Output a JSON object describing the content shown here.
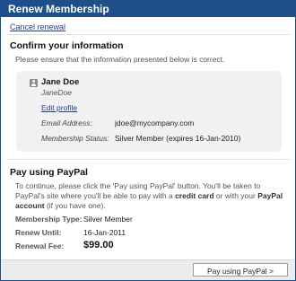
{
  "window": {
    "title": "Renew Membership"
  },
  "cancel_link": "Cancel renewal",
  "confirm": {
    "heading": "Confirm your information",
    "note": "Please ensure that the information presented below is correct.",
    "user": {
      "name": "Jane Doe",
      "handle": "JaneDoe"
    },
    "edit_link": "Edit profile",
    "email_label": "Email Address:",
    "email_value": "jdoe@mycompany.com",
    "status_label": "Membership Status:",
    "status_value": "Silver Member (expires 16-Jan-2010)"
  },
  "paypal": {
    "heading": "Pay using PayPal",
    "text_1": "To continue, please click the 'Pay using PayPal' button. You'll be taken to PayPal's site where you'll be able to pay with a ",
    "text_bold_1": "credit card",
    "text_2": " or with your ",
    "text_bold_2": "PayPal account",
    "text_3": " (if you have one).",
    "type_label": "Membership Type:",
    "type_value": "Silver Member",
    "renew_label": "Renew Until:",
    "renew_value": "16-Jan-2011",
    "fee_label": "Renewal Fee:",
    "fee_value": "$99.00"
  },
  "footer": {
    "button_label": "Pay using PayPal >"
  },
  "colors": {
    "titlebar": "#1f4f8a",
    "infobox": "#f1f1f1",
    "link": "#1f3f8a"
  }
}
